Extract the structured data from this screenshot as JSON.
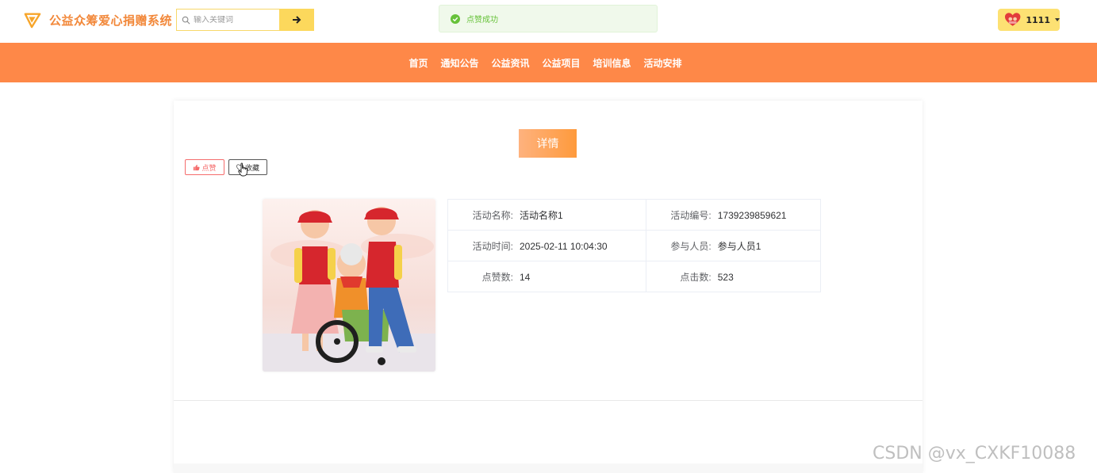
{
  "header": {
    "site_title": "公益众筹爱心捐赠系统",
    "search_placeholder": "输入关键词",
    "user_name": "1111",
    "logo_icon": "paper-plane-icon",
    "accent": "#f2883a"
  },
  "toast": {
    "message": "点赞成功",
    "color": "#67c23a"
  },
  "nav": {
    "items": [
      "首页",
      "通知公告",
      "公益资讯",
      "公益项目",
      "培训信息",
      "活动安排"
    ],
    "background": "#fe8848"
  },
  "detail": {
    "tab_title": "详情",
    "like_label": "点赞",
    "favorite_label": "收藏",
    "fields": [
      {
        "label": "活动名称:",
        "value": "活动名称1"
      },
      {
        "label": "活动编号:",
        "value": "1739239859621"
      },
      {
        "label": "活动时间:",
        "value": "2025-02-11 10:04:30"
      },
      {
        "label": "参与人员:",
        "value": "参与人员1"
      },
      {
        "label": "点赞数:",
        "value": "14"
      },
      {
        "label": "点击数:",
        "value": "523"
      }
    ]
  },
  "watermark": "CSDN @vx_CXKF10088"
}
